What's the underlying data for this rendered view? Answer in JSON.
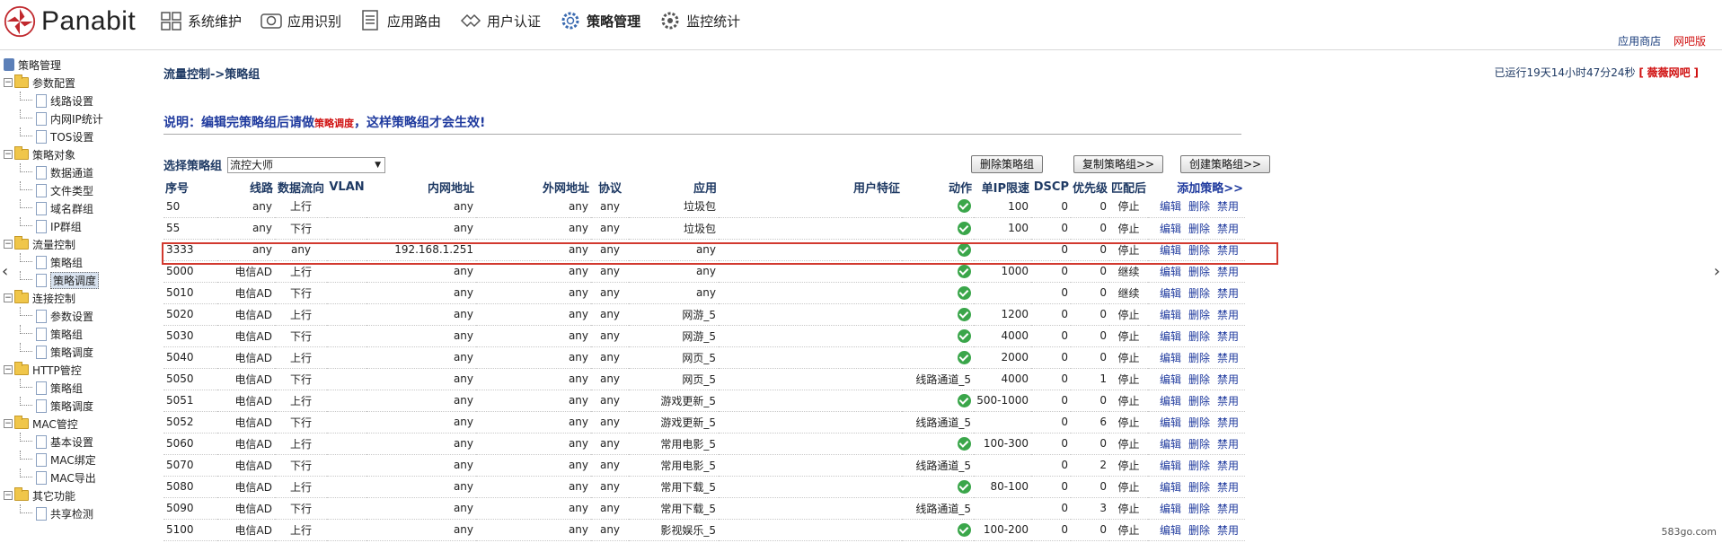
{
  "header": {
    "brand": "Panabit",
    "nav": [
      {
        "label": "系统维护",
        "icon": "system-maintenance-icon"
      },
      {
        "label": "应用识别",
        "icon": "app-recognition-icon"
      },
      {
        "label": "应用路由",
        "icon": "app-routing-icon"
      },
      {
        "label": "用户认证",
        "icon": "user-auth-icon"
      },
      {
        "label": "策略管理",
        "icon": "policy-gear-icon"
      },
      {
        "label": "监控统计",
        "icon": "monitor-stats-icon"
      }
    ],
    "app_store": "应用商店",
    "netbar": "网吧版"
  },
  "sidebar": {
    "root": "策略管理",
    "groups": [
      {
        "label": "参数配置",
        "items": [
          "线路设置",
          "内网IP统计",
          "TOS设置"
        ]
      },
      {
        "label": "策略对象",
        "items": [
          "数据通道",
          "文件类型",
          "域名群组",
          "IP群组"
        ]
      },
      {
        "label": "流量控制",
        "items": [
          "策略组",
          "策略调度"
        ]
      },
      {
        "label": "连接控制",
        "items": [
          "参数设置",
          "策略组",
          "策略调度"
        ]
      },
      {
        "label": "HTTP管控",
        "items": [
          "策略组",
          "策略调度"
        ]
      },
      {
        "label": "MAC管控",
        "items": [
          "基本设置",
          "MAC绑定",
          "MAC导出"
        ]
      },
      {
        "label": "其它功能",
        "items": [
          "共享检测"
        ]
      }
    ]
  },
  "main": {
    "breadcrumb": "流量控制->策略组",
    "runtime_prefix": "已运行19天14小时47分24秒",
    "runtime_open": "[",
    "runtime_name": "薇薇网吧",
    "runtime_close": "]",
    "notice_a": "说明：编辑完策略组后请做",
    "notice_b": "策略调度",
    "notice_c": "，这样策略组才会生效!",
    "select_label": "选择策略组",
    "select_value": "流控大师",
    "btn_delete": "删除策略组",
    "btn_copy": "复制策略组>>",
    "btn_create": "创建策略组>>",
    "columns": [
      "序号",
      "线路",
      "数据流向",
      "VLAN",
      "内网地址",
      "外网地址",
      "协议",
      "应用",
      "用户特征",
      "动作",
      "单IP限速",
      "DSCP",
      "优先级",
      "匹配后"
    ],
    "add_policy": "添加策略>>",
    "actions": {
      "edit": "编辑",
      "delete": "删除",
      "disable": "禁用"
    },
    "rows": [
      {
        "id": "50",
        "line": "any",
        "dir": "上行",
        "vlan": "",
        "lan": "any",
        "wan": "any",
        "proto": "any",
        "app": "垃圾包",
        "feat": "",
        "action": "",
        "ok": true,
        "rate": "100",
        "dscp": "0",
        "pri": "0",
        "after": "停止"
      },
      {
        "id": "55",
        "line": "any",
        "dir": "下行",
        "vlan": "",
        "lan": "any",
        "wan": "any",
        "proto": "any",
        "app": "垃圾包",
        "feat": "",
        "action": "",
        "ok": true,
        "rate": "100",
        "dscp": "0",
        "pri": "0",
        "after": "停止"
      },
      {
        "id": "3333",
        "line": "any",
        "dir": "any",
        "vlan": "",
        "lan": "192.168.1.251",
        "wan": "any",
        "proto": "any",
        "app": "any",
        "feat": "",
        "action": "",
        "ok": true,
        "rate": "",
        "dscp": "0",
        "pri": "0",
        "after": "停止"
      },
      {
        "id": "5000",
        "line": "电信AD",
        "dir": "上行",
        "vlan": "",
        "lan": "any",
        "wan": "any",
        "proto": "any",
        "app": "any",
        "feat": "",
        "action": "",
        "ok": true,
        "rate": "1000",
        "dscp": "0",
        "pri": "0",
        "after": "继续"
      },
      {
        "id": "5010",
        "line": "电信AD",
        "dir": "下行",
        "vlan": "",
        "lan": "any",
        "wan": "any",
        "proto": "any",
        "app": "any",
        "feat": "",
        "action": "",
        "ok": true,
        "rate": "",
        "dscp": "0",
        "pri": "0",
        "after": "继续"
      },
      {
        "id": "5020",
        "line": "电信AD",
        "dir": "上行",
        "vlan": "",
        "lan": "any",
        "wan": "any",
        "proto": "any",
        "app": "网游_5",
        "feat": "",
        "action": "",
        "ok": true,
        "rate": "1200",
        "dscp": "0",
        "pri": "0",
        "after": "停止"
      },
      {
        "id": "5030",
        "line": "电信AD",
        "dir": "下行",
        "vlan": "",
        "lan": "any",
        "wan": "any",
        "proto": "any",
        "app": "网游_5",
        "feat": "",
        "action": "",
        "ok": true,
        "rate": "4000",
        "dscp": "0",
        "pri": "0",
        "after": "停止"
      },
      {
        "id": "5040",
        "line": "电信AD",
        "dir": "上行",
        "vlan": "",
        "lan": "any",
        "wan": "any",
        "proto": "any",
        "app": "网页_5",
        "feat": "",
        "action": "",
        "ok": true,
        "rate": "2000",
        "dscp": "0",
        "pri": "0",
        "after": "停止"
      },
      {
        "id": "5050",
        "line": "电信AD",
        "dir": "下行",
        "vlan": "",
        "lan": "any",
        "wan": "any",
        "proto": "any",
        "app": "网页_5",
        "feat": "",
        "action": "线路通道_5",
        "ok": false,
        "rate": "4000",
        "dscp": "0",
        "pri": "1",
        "after": "停止"
      },
      {
        "id": "5051",
        "line": "电信AD",
        "dir": "上行",
        "vlan": "",
        "lan": "any",
        "wan": "any",
        "proto": "any",
        "app": "游戏更新_5",
        "feat": "",
        "action": "",
        "ok": true,
        "rate": "500-1000",
        "dscp": "0",
        "pri": "0",
        "after": "停止"
      },
      {
        "id": "5052",
        "line": "电信AD",
        "dir": "下行",
        "vlan": "",
        "lan": "any",
        "wan": "any",
        "proto": "any",
        "app": "游戏更新_5",
        "feat": "",
        "action": "线路通道_5",
        "ok": false,
        "rate": "",
        "dscp": "0",
        "pri": "6",
        "after": "停止"
      },
      {
        "id": "5060",
        "line": "电信AD",
        "dir": "上行",
        "vlan": "",
        "lan": "any",
        "wan": "any",
        "proto": "any",
        "app": "常用电影_5",
        "feat": "",
        "action": "",
        "ok": true,
        "rate": "100-300",
        "dscp": "0",
        "pri": "0",
        "after": "停止"
      },
      {
        "id": "5070",
        "line": "电信AD",
        "dir": "下行",
        "vlan": "",
        "lan": "any",
        "wan": "any",
        "proto": "any",
        "app": "常用电影_5",
        "feat": "",
        "action": "线路通道_5",
        "ok": false,
        "rate": "",
        "dscp": "0",
        "pri": "2",
        "after": "停止"
      },
      {
        "id": "5080",
        "line": "电信AD",
        "dir": "上行",
        "vlan": "",
        "lan": "any",
        "wan": "any",
        "proto": "any",
        "app": "常用下载_5",
        "feat": "",
        "action": "",
        "ok": true,
        "rate": "80-100",
        "dscp": "0",
        "pri": "0",
        "after": "停止"
      },
      {
        "id": "5090",
        "line": "电信AD",
        "dir": "下行",
        "vlan": "",
        "lan": "any",
        "wan": "any",
        "proto": "any",
        "app": "常用下载_5",
        "feat": "",
        "action": "线路通道_5",
        "ok": false,
        "rate": "",
        "dscp": "0",
        "pri": "3",
        "after": "停止"
      },
      {
        "id": "5100",
        "line": "电信AD",
        "dir": "上行",
        "vlan": "",
        "lan": "any",
        "wan": "any",
        "proto": "any",
        "app": "影视娱乐_5",
        "feat": "",
        "action": "",
        "ok": true,
        "rate": "100-200",
        "dscp": "0",
        "pri": "0",
        "after": "停止"
      }
    ]
  },
  "watermark": "583go.com"
}
